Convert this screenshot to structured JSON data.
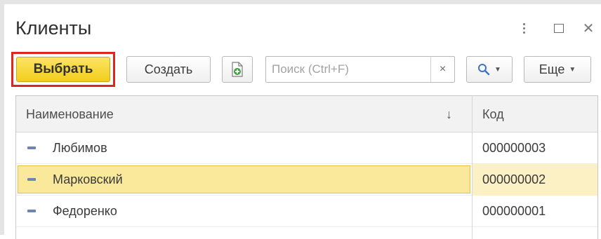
{
  "window": {
    "title": "Клиенты"
  },
  "toolbar": {
    "select_label": "Выбрать",
    "create_label": "Создать",
    "search_placeholder": "Поиск (Ctrl+F)",
    "search_value": "",
    "clear_symbol": "×",
    "find_symbol": "🔍",
    "more_label": "Еще"
  },
  "table": {
    "columns": {
      "name": "Наименование",
      "sort_indicator": "↓",
      "code": "Код"
    },
    "rows": [
      {
        "name": "Любимов",
        "code": "000000003",
        "selected": false
      },
      {
        "name": "Марковский",
        "code": "000000002",
        "selected": true
      },
      {
        "name": "Федоренко",
        "code": "000000001",
        "selected": false
      }
    ]
  },
  "colors": {
    "accent_yellow": "#f2cd1c",
    "highlight_red": "#e0261c",
    "selection": "#fbe99b"
  }
}
